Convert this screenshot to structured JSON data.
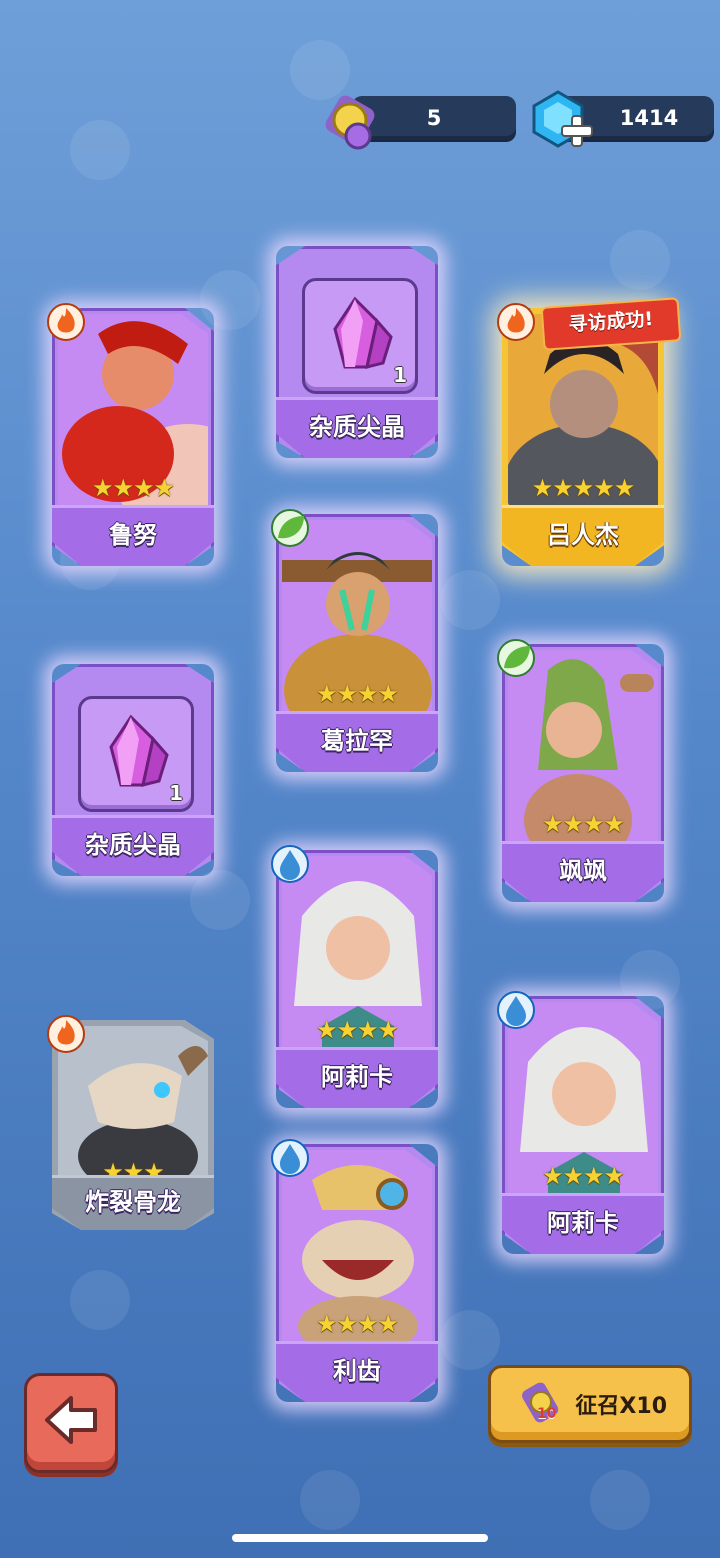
{
  "currency": {
    "scroll_count": "5",
    "gem_count": "1414"
  },
  "cards": [
    {
      "name": "鲁努",
      "stars": "★★★★",
      "element": "fire",
      "rarity": "purple"
    },
    {
      "name": "杂质尖晶",
      "count": "1",
      "type": "item"
    },
    {
      "name": "吕人杰",
      "stars": "★★★★★",
      "element": "fire",
      "rarity": "gold",
      "badge": "寻访成功!"
    },
    {
      "name": "葛拉罕",
      "stars": "★★★★",
      "element": "leaf",
      "rarity": "purple"
    },
    {
      "name": "杂质尖晶",
      "count": "1",
      "type": "item"
    },
    {
      "name": "飒飒",
      "stars": "★★★★",
      "element": "leaf",
      "rarity": "purple"
    },
    {
      "name": "阿莉卡",
      "stars": "★★★★",
      "element": "water",
      "rarity": "purple"
    },
    {
      "name": "炸裂骨龙",
      "stars": "★★★",
      "element": "fire",
      "rarity": "gray"
    },
    {
      "name": "阿莉卡",
      "stars": "★★★★",
      "element": "water",
      "rarity": "purple"
    },
    {
      "name": "利齿",
      "stars": "★★★★",
      "element": "water",
      "rarity": "purple"
    }
  ],
  "buttons": {
    "recruit_label": "征召X10",
    "recruit_badge": "10",
    "back_icon": "arrow-left-icon"
  }
}
